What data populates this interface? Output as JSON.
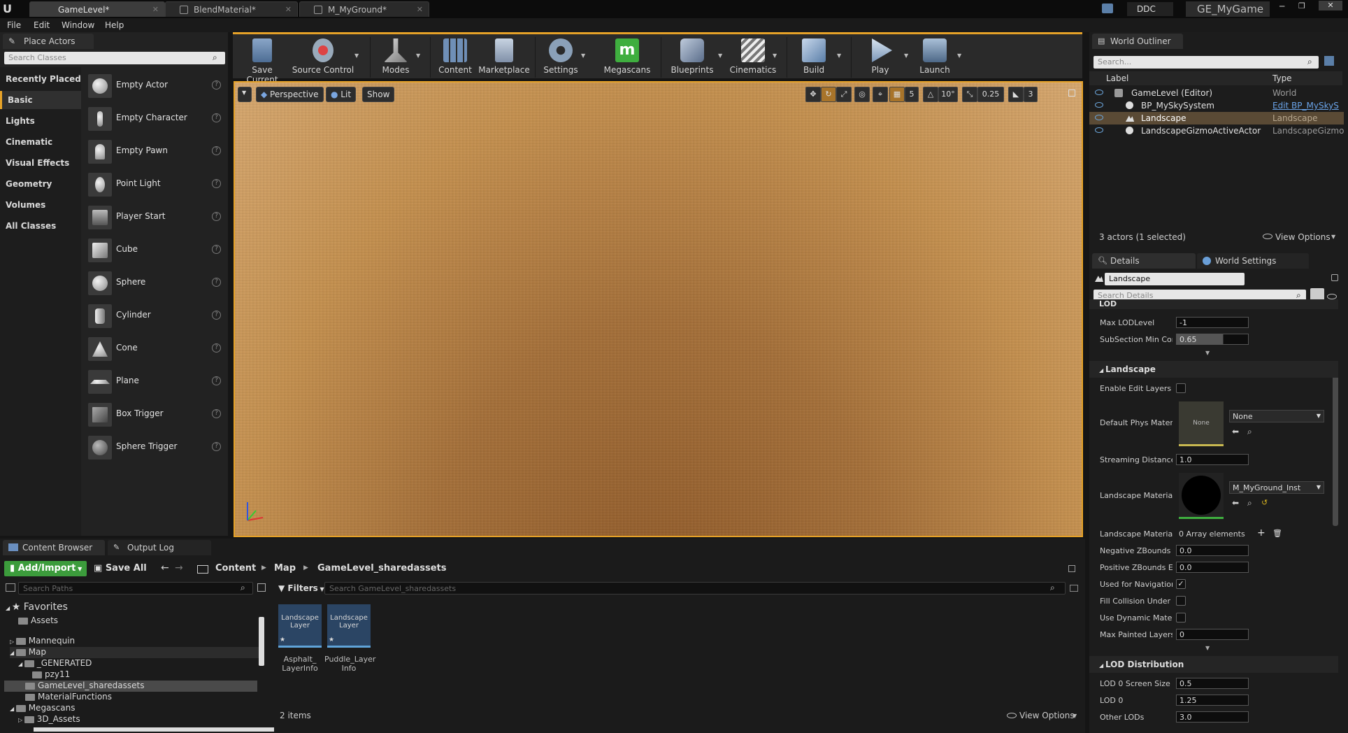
{
  "titlebar": {
    "tabs": [
      {
        "label": "GameLevel*"
      },
      {
        "label": "BlendMaterial*"
      },
      {
        "label": "M_MyGround*"
      }
    ],
    "ddc": "DDC",
    "project": "GE_MyGame"
  },
  "menu": [
    "File",
    "Edit",
    "Window",
    "Help"
  ],
  "place_actors": {
    "tab": "Place Actors",
    "search_placeholder": "Search Classes",
    "categories": [
      "Recently Placed",
      "Basic",
      "Lights",
      "Cinematic",
      "Visual Effects",
      "Geometry",
      "Volumes",
      "All Classes"
    ],
    "actors": [
      "Empty Actor",
      "Empty Character",
      "Empty Pawn",
      "Point Light",
      "Player Start",
      "Cube",
      "Sphere",
      "Cylinder",
      "Cone",
      "Plane",
      "Box Trigger",
      "Sphere Trigger"
    ]
  },
  "toolbar": {
    "buttons": [
      "Save Current",
      "Source Control",
      "Modes",
      "Content",
      "Marketplace",
      "Settings",
      "Megascans",
      "Blueprints",
      "Cinematics",
      "Build",
      "Play",
      "Launch"
    ]
  },
  "viewport": {
    "perspective": "Perspective",
    "lit": "Lit",
    "show": "Show",
    "grid_snap": "5",
    "rot_snap": "10°",
    "scale_snap": "0.25",
    "cam_speed": "3"
  },
  "outliner": {
    "tab": "World Outliner",
    "search_placeholder": "Search...",
    "col_label": "Label",
    "col_type": "Type",
    "rows": [
      {
        "label": "GameLevel (Editor)",
        "type": "World"
      },
      {
        "label": "BP_MySkySystem",
        "type": "Edit BP_MySkyS"
      },
      {
        "label": "Landscape",
        "type": "Landscape"
      },
      {
        "label": "LandscapeGizmoActiveActor",
        "type": "LandscapeGizmo"
      }
    ],
    "status": "3 actors (1 selected)",
    "view_options": "View Options"
  },
  "details": {
    "tab": "Details",
    "tab2": "World Settings",
    "name": "Landscape",
    "search_placeholder": "Search Details",
    "lod_header": "LOD",
    "lod_props": [
      {
        "label": "Max LODLevel",
        "value": "-1"
      },
      {
        "label": "SubSection Min Com",
        "value": "0.65"
      }
    ],
    "landscape_header": "Landscape",
    "enable_edit_layers": "Enable Edit Layers",
    "default_phys": "Default Phys Materia",
    "phys_none_thumb": "None",
    "phys_value": "None",
    "streaming": {
      "label": "Streaming Distance I",
      "value": "1.0"
    },
    "landscape_material": "Landscape Material",
    "material_value": "M_MyGround_Inst",
    "materials_override": {
      "label": "Landscape Materials",
      "value": "0 Array elements"
    },
    "neg_z": {
      "label": "Negative ZBounds Ex",
      "value": "0.0"
    },
    "pos_z": {
      "label": "Positive ZBounds Ex",
      "value": "0.0"
    },
    "used_nav": "Used for Navigation",
    "fill_collision": "Fill Collision Under La",
    "dyn_material": "Use Dynamic Materi",
    "max_painted": {
      "label": "Max Painted Layers",
      "value": "0"
    },
    "lod_dist_header": "LOD Distribution",
    "lod0_screen": {
      "label": "LOD 0 Screen Size",
      "value": "0.5"
    },
    "lod0": {
      "label": "LOD 0",
      "value": "1.25"
    },
    "other_lods": {
      "label": "Other LODs",
      "value": "3.0"
    }
  },
  "content_browser": {
    "tab": "Content Browser",
    "tab2": "Output Log",
    "add_import": "Add/Import",
    "save_all": "Save All",
    "crumbs": [
      "Content",
      "Map",
      "GameLevel_sharedassets"
    ],
    "search_paths": "Search Paths",
    "favorites": "Favorites",
    "folders": [
      "Assets",
      "Mannequin",
      "Map",
      "_GENERATED",
      "pzy11",
      "GameLevel_sharedassets",
      "MaterialFunctions",
      "Megascans",
      "3D_Assets"
    ],
    "filters": "Filters",
    "asset_search": "Search GameLevel_sharedassets",
    "assets": [
      {
        "thumb": "Landscape Layer",
        "name": "Asphalt_ LayerInfo"
      },
      {
        "thumb": "Landscape Layer",
        "name": "Puddle_Layer Info"
      }
    ],
    "item_count": "2 items",
    "view_options": "View Options"
  }
}
